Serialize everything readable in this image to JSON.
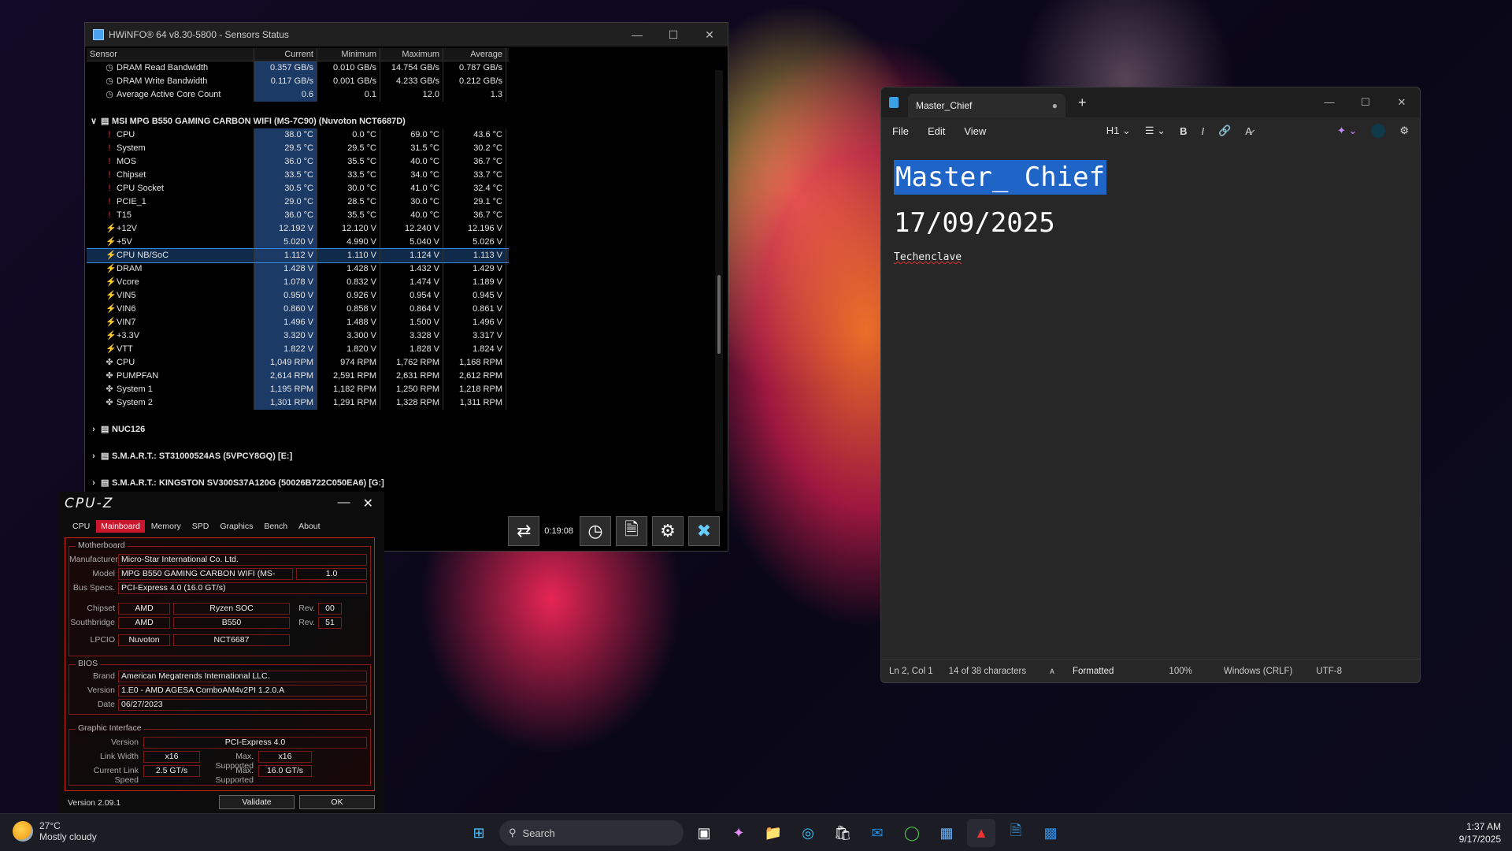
{
  "hwinfo": {
    "title": "HWiNFO® 64 v8.30-5800 - Sensors Status",
    "columns": [
      "Sensor",
      "Current",
      "Minimum",
      "Maximum",
      "Average"
    ],
    "rows": [
      {
        "kind": "c",
        "name": "DRAM Read Bandwidth",
        "cur": "0.357 GB/s",
        "min": "0.010 GB/s",
        "max": "14.754 GB/s",
        "avg": "0.787 GB/s"
      },
      {
        "kind": "c",
        "name": "DRAM Write Bandwidth",
        "cur": "0.117 GB/s",
        "min": "0.001 GB/s",
        "max": "4.233 GB/s",
        "avg": "0.212 GB/s"
      },
      {
        "kind": "c",
        "name": "Average Active Core Count",
        "cur": "0.6",
        "min": "0.1",
        "max": "12.0",
        "avg": "1.3"
      },
      {
        "kind": "blank"
      },
      {
        "kind": "group",
        "name": "MSI MPG B550 GAMING CARBON WIFI (MS-7C90) (Nuvoton NCT6687D)",
        "exp": "v"
      },
      {
        "kind": "t",
        "name": "CPU",
        "cur": "38.0 °C",
        "min": "0.0 °C",
        "max": "69.0 °C",
        "avg": "43.6 °C"
      },
      {
        "kind": "t",
        "name": "System",
        "cur": "29.5 °C",
        "min": "29.5 °C",
        "max": "31.5 °C",
        "avg": "30.2 °C"
      },
      {
        "kind": "t",
        "name": "MOS",
        "cur": "36.0 °C",
        "min": "35.5 °C",
        "max": "40.0 °C",
        "avg": "36.7 °C"
      },
      {
        "kind": "t",
        "name": "Chipset",
        "cur": "33.5 °C",
        "min": "33.5 °C",
        "max": "34.0 °C",
        "avg": "33.7 °C"
      },
      {
        "kind": "t",
        "name": "CPU Socket",
        "cur": "30.5 °C",
        "min": "30.0 °C",
        "max": "41.0 °C",
        "avg": "32.4 °C"
      },
      {
        "kind": "t",
        "name": "PCIE_1",
        "cur": "29.0 °C",
        "min": "28.5 °C",
        "max": "30.0 °C",
        "avg": "29.1 °C"
      },
      {
        "kind": "t",
        "name": "T15",
        "cur": "36.0 °C",
        "min": "35.5 °C",
        "max": "40.0 °C",
        "avg": "36.7 °C"
      },
      {
        "kind": "v",
        "name": "+12V",
        "cur": "12.192 V",
        "min": "12.120 V",
        "max": "12.240 V",
        "avg": "12.196 V"
      },
      {
        "kind": "v",
        "name": "+5V",
        "cur": "5.020 V",
        "min": "4.990 V",
        "max": "5.040 V",
        "avg": "5.026 V"
      },
      {
        "kind": "v",
        "name": "CPU NB/SoC",
        "cur": "1.112 V",
        "min": "1.110 V",
        "max": "1.124 V",
        "avg": "1.113 V",
        "sel": true
      },
      {
        "kind": "v",
        "name": "DRAM",
        "cur": "1.428 V",
        "min": "1.428 V",
        "max": "1.432 V",
        "avg": "1.429 V"
      },
      {
        "kind": "v",
        "name": "Vcore",
        "cur": "1.078 V",
        "min": "0.832 V",
        "max": "1.474 V",
        "avg": "1.189 V"
      },
      {
        "kind": "v",
        "name": "VIN5",
        "cur": "0.950 V",
        "min": "0.926 V",
        "max": "0.954 V",
        "avg": "0.945 V"
      },
      {
        "kind": "v",
        "name": "VIN6",
        "cur": "0.860 V",
        "min": "0.858 V",
        "max": "0.864 V",
        "avg": "0.861 V"
      },
      {
        "kind": "v",
        "name": "VIN7",
        "cur": "1.496 V",
        "min": "1.488 V",
        "max": "1.500 V",
        "avg": "1.496 V"
      },
      {
        "kind": "v",
        "name": "+3.3V",
        "cur": "3.320 V",
        "min": "3.300 V",
        "max": "3.328 V",
        "avg": "3.317 V"
      },
      {
        "kind": "v",
        "name": "VTT",
        "cur": "1.822 V",
        "min": "1.820 V",
        "max": "1.828 V",
        "avg": "1.824 V"
      },
      {
        "kind": "f",
        "name": "CPU",
        "cur": "1,049 RPM",
        "min": "974 RPM",
        "max": "1,762 RPM",
        "avg": "1,168 RPM"
      },
      {
        "kind": "f",
        "name": "PUMPFAN",
        "cur": "2,614 RPM",
        "min": "2,591 RPM",
        "max": "2,631 RPM",
        "avg": "2,612 RPM"
      },
      {
        "kind": "f",
        "name": "System 1",
        "cur": "1,195 RPM",
        "min": "1,182 RPM",
        "max": "1,250 RPM",
        "avg": "1,218 RPM"
      },
      {
        "kind": "f",
        "name": "System 2",
        "cur": "1,301 RPM",
        "min": "1,291 RPM",
        "max": "1,328 RPM",
        "avg": "1,311 RPM"
      },
      {
        "kind": "blank"
      },
      {
        "kind": "group",
        "name": "NUC126",
        "exp": ">"
      },
      {
        "kind": "blank"
      },
      {
        "kind": "group",
        "name": "S.M.A.R.T.: ST31000524AS (5VPCY8GQ) [E:]",
        "exp": ">"
      },
      {
        "kind": "blank"
      },
      {
        "kind": "group",
        "name": "S.M.A.R.T.: KINGSTON SV300S37A120G (50026B722C050EA6) [G:]",
        "exp": ">"
      }
    ],
    "timer": "0:19:08"
  },
  "cpuz": {
    "logo": "CPU-Z",
    "tabs": [
      "CPU",
      "Mainboard",
      "Memory",
      "SPD",
      "Graphics",
      "Bench",
      "About"
    ],
    "active_tab": "Mainboard",
    "motherboard_legend": "Motherboard",
    "manufacturer_label": "Manufacturer",
    "manufacturer": "Micro-Star International Co. Ltd.",
    "model_label": "Model",
    "model": "MPG B550 GAMING CARBON WIFI (MS-",
    "model_rev": "1.0",
    "busspecs_label": "Bus Specs.",
    "busspecs": "PCI-Express 4.0 (16.0 GT/s)",
    "chipset_label": "Chipset",
    "chipset_vendor": "AMD",
    "chipset_name": "Ryzen SOC",
    "chipset_rev_label": "Rev.",
    "chipset_rev": "00",
    "southbridge_label": "Southbridge",
    "sb_vendor": "AMD",
    "sb_name": "B550",
    "sb_rev_label": "Rev.",
    "sb_rev": "51",
    "lpcio_label": "LPCIO",
    "lpcio_vendor": "Nuvoton",
    "lpcio_name": "NCT6687",
    "bios_legend": "BIOS",
    "brand_label": "Brand",
    "bios_brand": "American Megatrends International LLC.",
    "version_label": "Version",
    "bios_version": "1.E0 - AMD AGESA ComboAM4v2PI 1.2.0.A",
    "date_label": "Date",
    "bios_date": "06/27/2023",
    "gi_legend": "Graphic Interface",
    "gi_version_label": "Version",
    "gi_version": "PCI-Express 4.0",
    "linkwidth_label": "Link Width",
    "link_width": "x16",
    "max_supported_label": "Max. Supported",
    "max_width": "x16",
    "linkspeed_label": "Current Link Speed",
    "link_speed": "2.5 GT/s",
    "max_supported_label2": "Max. Supported",
    "max_speed": "16.0 GT/s",
    "version": "Version 2.09.1",
    "validate": "Validate",
    "ok": "OK"
  },
  "notepad": {
    "tab_title": "Master_Chief",
    "menu": [
      "File",
      "Edit",
      "View"
    ],
    "heading_select": "H1",
    "heading": "Master_ Chief",
    "date": "17/09/2025",
    "text": "Techenclave",
    "status": {
      "position": "Ln 2, Col 1",
      "chars": "14 of 38 characters",
      "format": "Formatted",
      "zoom": "100%",
      "eol": "Windows (CRLF)",
      "encoding": "UTF-8"
    }
  },
  "taskbar": {
    "weather_temp": "27°C",
    "weather_desc": "Mostly cloudy",
    "search": "Search",
    "time": "1:37 AM",
    "date": "9/17/2025"
  }
}
